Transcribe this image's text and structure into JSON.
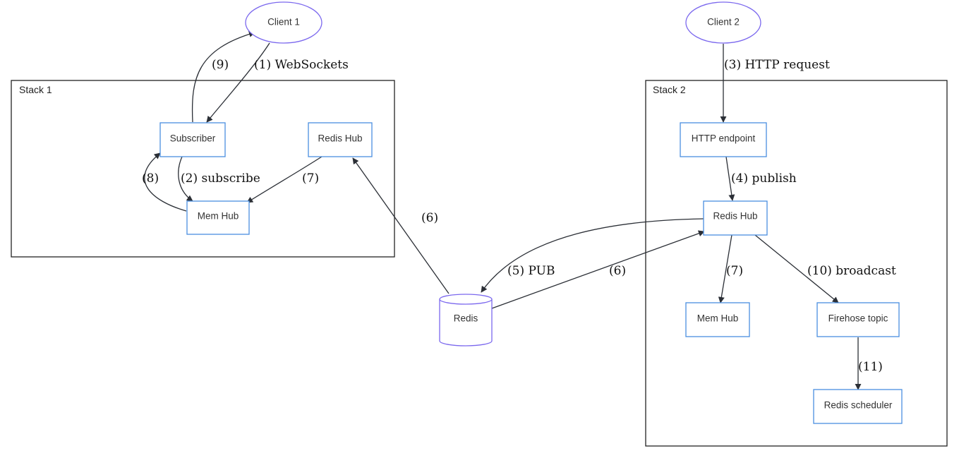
{
  "diagram": {
    "clusters": [
      {
        "id": "stack1",
        "label": "Stack 1"
      },
      {
        "id": "stack2",
        "label": "Stack 2"
      }
    ],
    "nodes": [
      {
        "id": "client1",
        "label": "Client 1",
        "shape": "ellipse"
      },
      {
        "id": "client2",
        "label": "Client 2",
        "shape": "ellipse"
      },
      {
        "id": "s1_subscriber",
        "label": "Subscriber",
        "shape": "box",
        "cluster": "stack1"
      },
      {
        "id": "s1_redishub",
        "label": "Redis Hub",
        "shape": "box",
        "cluster": "stack1"
      },
      {
        "id": "s1_memhub",
        "label": "Mem Hub",
        "shape": "box",
        "cluster": "stack1"
      },
      {
        "id": "redis",
        "label": "Redis",
        "shape": "cylinder"
      },
      {
        "id": "s2_http",
        "label": "HTTP endpoint",
        "shape": "box",
        "cluster": "stack2"
      },
      {
        "id": "s2_redishub",
        "label": "Redis Hub",
        "shape": "box",
        "cluster": "stack2"
      },
      {
        "id": "s2_memhub",
        "label": "Mem Hub",
        "shape": "box",
        "cluster": "stack2"
      },
      {
        "id": "s2_firehose",
        "label": "Firehose topic",
        "shape": "box",
        "cluster": "stack2"
      },
      {
        "id": "s2_scheduler",
        "label": "Redis scheduler",
        "shape": "box",
        "cluster": "stack2"
      }
    ],
    "edges": [
      {
        "from": "client1",
        "to": "s1_subscriber",
        "label": "(1) WebSockets"
      },
      {
        "from": "s1_subscriber",
        "to": "s1_memhub",
        "label": "(2) subscribe"
      },
      {
        "from": "client2",
        "to": "s2_http",
        "label": "(3) HTTP request"
      },
      {
        "from": "s2_http",
        "to": "s2_redishub",
        "label": "(4) publish"
      },
      {
        "from": "s2_redishub",
        "to": "redis",
        "label": "(5) PUB"
      },
      {
        "from": "redis",
        "to": "s1_redishub",
        "label": "(6)"
      },
      {
        "from": "redis",
        "to": "s2_redishub",
        "label": "(6)"
      },
      {
        "from": "s1_redishub",
        "to": "s1_memhub",
        "label": "(7)"
      },
      {
        "from": "s2_redishub",
        "to": "s2_memhub",
        "label": "(7)"
      },
      {
        "from": "s1_memhub",
        "to": "s1_subscriber",
        "label": "(8)"
      },
      {
        "from": "s1_subscriber",
        "to": "client1",
        "label": "(9)"
      },
      {
        "from": "s2_redishub",
        "to": "s2_firehose",
        "label": "(10) broadcast"
      },
      {
        "from": "s2_firehose",
        "to": "s2_scheduler",
        "label": "(11)"
      }
    ],
    "colors": {
      "box_stroke": "#4a8fe0",
      "ellipse_stroke": "#7b68ee",
      "edge": "#2b2f36"
    }
  }
}
